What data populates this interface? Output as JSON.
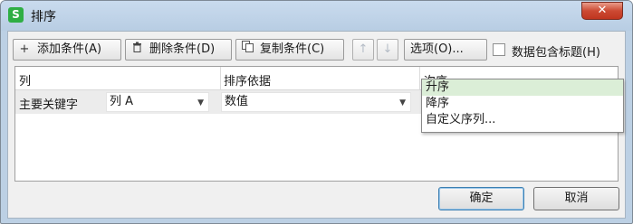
{
  "window": {
    "title": "排序",
    "app_icon_glyph": "S",
    "close_glyph": "✕"
  },
  "toolbar": {
    "add_label": "添加条件(A)",
    "delete_label": "删除条件(D)",
    "copy_label": "复制条件(C)",
    "move_up_glyph": "↑",
    "move_down_glyph": "↓",
    "options_label": "选项(O)...",
    "header_checkbox_label": "数据包含标题(H)",
    "header_checkbox_checked": false
  },
  "grid": {
    "columns": [
      "列",
      "排序依据",
      "次序"
    ],
    "rows": [
      {
        "key_label": "主要关键字",
        "column_value": "列 A",
        "sort_on_value": "数值",
        "order_value": "升序"
      }
    ]
  },
  "order_dropdown": {
    "options": [
      "升序",
      "降序",
      "自定义序列..."
    ],
    "highlighted": "升序"
  },
  "footer": {
    "ok_label": "确定",
    "cancel_label": "取消"
  },
  "icons": {
    "add": "plus-icon",
    "delete": "trash-icon",
    "copy": "copy-icon",
    "move_up": "arrow-up-icon",
    "move_down": "arrow-down-icon",
    "app": "wps-spreadsheet-icon",
    "close": "close-icon"
  },
  "colors": {
    "title_bar": "#bcd0e4",
    "dropdown_highlight": "#dbeed7",
    "close_button": "#c7412b",
    "app_icon": "#2fae44"
  }
}
